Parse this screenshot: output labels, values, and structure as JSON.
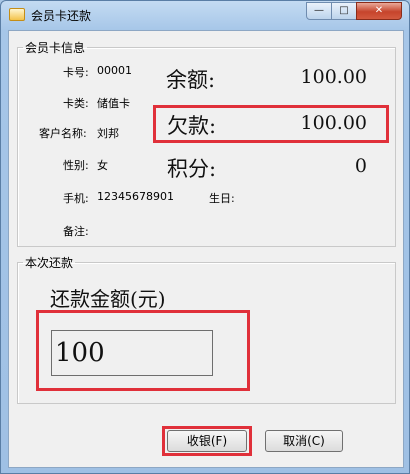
{
  "window": {
    "title": "会员卡还款",
    "min_glyph": "—",
    "max_glyph": "□",
    "close_glyph": "✕"
  },
  "info_group": {
    "legend": "会员卡信息",
    "card_no_label": "卡号:",
    "card_no": "00001",
    "card_type_label": "卡类:",
    "card_type": "储值卡",
    "customer_label": "客户名称:",
    "customer": "刘邦",
    "gender_label": "性别:",
    "gender": "女",
    "phone_label": "手机:",
    "phone": "12345678901",
    "birthday_label": "生日:",
    "birthday": "",
    "remark_label": "备注:",
    "remark": "",
    "balance_label": "余额:",
    "balance": "100.00",
    "debt_label": "欠款:",
    "debt": "100.00",
    "points_label": "积分:",
    "points": "0"
  },
  "repay_group": {
    "legend": "本次还款",
    "amount_label": "还款金额(元)",
    "amount_value": "100"
  },
  "buttons": {
    "confirm": "收银(F)",
    "cancel": "取消(C)"
  },
  "colors": {
    "highlight_red": "#e0303a"
  }
}
